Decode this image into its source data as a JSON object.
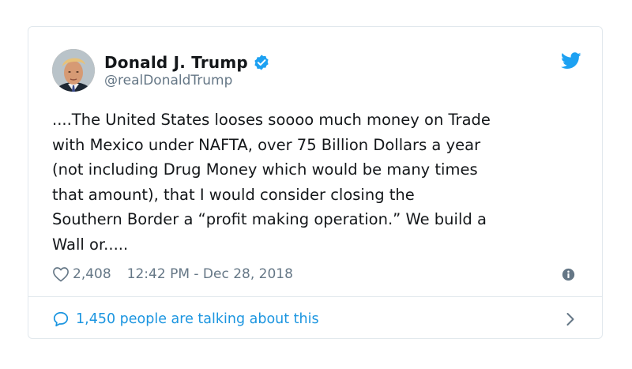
{
  "tweet": {
    "display_name": "Donald J. Trump",
    "handle": "@realDonaldTrump",
    "verified": true,
    "text": "....The United States looses soooo much money on Trade\nwith Mexico under NAFTA, over 75 Billion Dollars a year\n(not including Drug Money which would be many times\nthat amount), that I would consider closing the\nSouthern Border a “profit making operation.” We build a\nWall or.....",
    "likes": "2,408",
    "timestamp": "12:42 PM - Dec 28, 2018",
    "talking": "1,450 people are talking about this"
  },
  "icons": {
    "verified": "verified-badge-icon",
    "brand": "twitter-bird-icon",
    "like": "heart-icon",
    "info": "info-icon",
    "reply": "speech-bubble-icon",
    "chevron": "chevron-right-icon"
  },
  "colors": {
    "accent": "#1da1f2",
    "link": "#1b95e0",
    "muted": "#657786",
    "text": "#14171a",
    "border": "#e1e8ed"
  }
}
